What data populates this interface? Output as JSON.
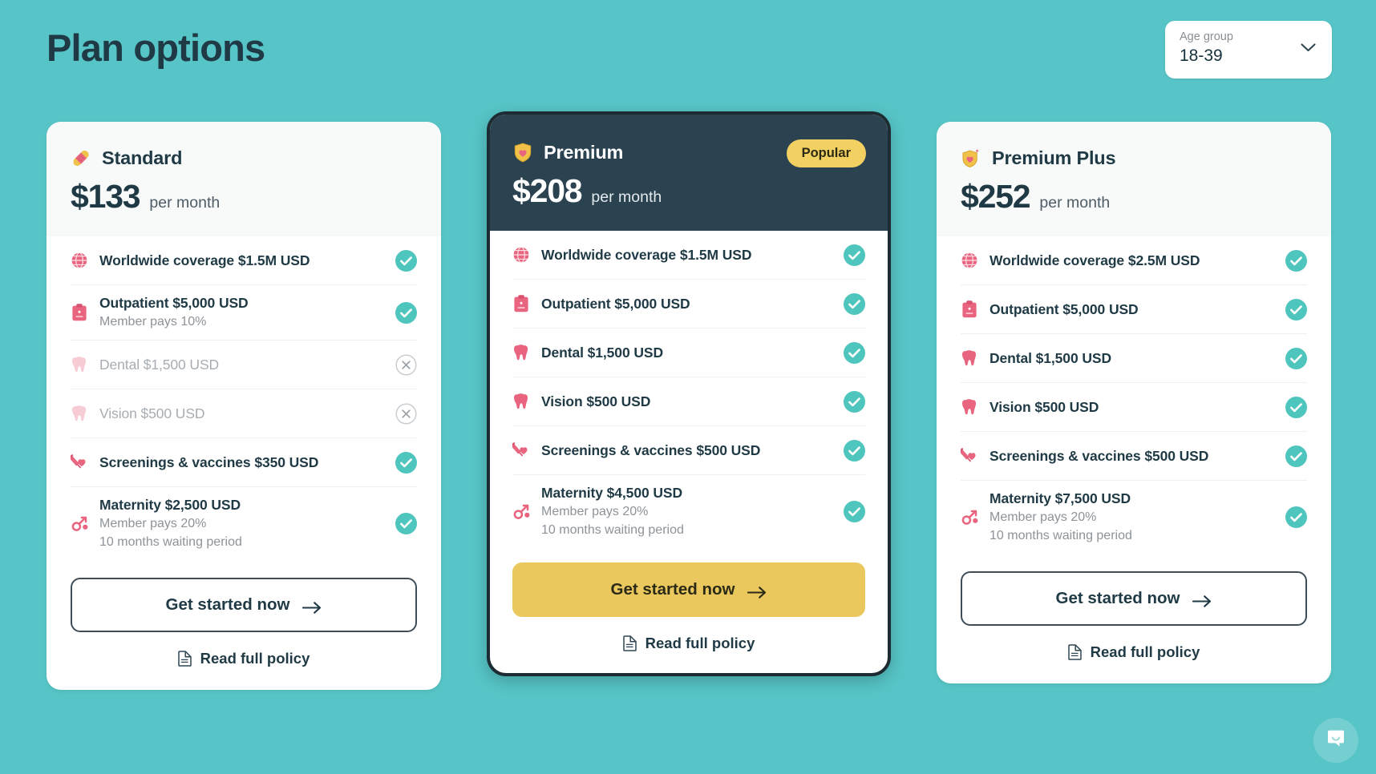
{
  "header": {
    "title": "Plan options",
    "age_group": {
      "label": "Age group",
      "value": "18-39",
      "chevron_icon": "chevron-down-icon"
    }
  },
  "common": {
    "cta_label": "Get started now",
    "policy_label": "Read full policy",
    "per_month": "per month",
    "arrow_icon": "arrow-right-icon",
    "doc_icon": "document-icon",
    "check_icon": "check-circle-icon",
    "cross_icon": "cross-circle-icon"
  },
  "colors": {
    "background_teal": "#57c5c7",
    "dark_navy": "#2b4250",
    "accent_yellow": "#ebc85e",
    "badge_yellow": "#f2d061",
    "check_teal": "#4ec5bd",
    "icon_pink": "#e8647f",
    "text_dark": "#1f3a45",
    "text_muted": "#8d9399",
    "text_disabled": "#a7adb2"
  },
  "chat": {
    "icon": "chat-bubble-icon"
  },
  "plans": [
    {
      "name": "Standard",
      "emoji_icon": "adhesive-bandage-icon",
      "price": "$133",
      "per_month": "per month",
      "featured": false,
      "badge": null,
      "cta_style": "outline",
      "features": [
        {
          "icon": "globe-icon",
          "title": "Worldwide coverage $1.5M USD",
          "subs": [],
          "included": true
        },
        {
          "icon": "clipboard-medical-icon",
          "title": "Outpatient $5,000 USD",
          "subs": [
            "Member pays 10%"
          ],
          "included": true
        },
        {
          "icon": "tooth-icon",
          "title": "Dental $1,500 USD",
          "subs": [],
          "included": false
        },
        {
          "icon": "tooth-icon",
          "title": "Vision $500 USD",
          "subs": [],
          "included": false
        },
        {
          "icon": "syringe-heart-icon",
          "title": "Screenings & vaccines $350 USD",
          "subs": [],
          "included": true
        },
        {
          "icon": "maternity-icon",
          "title": "Maternity $2,500 USD",
          "subs": [
            "Member pays 20%",
            "10 months waiting period"
          ],
          "included": true
        }
      ]
    },
    {
      "name": "Premium",
      "emoji_icon": "shield-heart-icon",
      "price": "$208",
      "per_month": "per month",
      "featured": true,
      "badge": "Popular",
      "cta_style": "primary",
      "features": [
        {
          "icon": "globe-icon",
          "title": "Worldwide coverage $1.5M USD",
          "subs": [],
          "included": true
        },
        {
          "icon": "clipboard-medical-icon",
          "title": "Outpatient $5,000 USD",
          "subs": [],
          "included": true
        },
        {
          "icon": "tooth-icon",
          "title": "Dental $1,500 USD",
          "subs": [],
          "included": true
        },
        {
          "icon": "tooth-icon",
          "title": "Vision $500 USD",
          "subs": [],
          "included": true
        },
        {
          "icon": "syringe-heart-icon",
          "title": "Screenings & vaccines $500 USD",
          "subs": [],
          "included": true
        },
        {
          "icon": "maternity-icon",
          "title": "Maternity $4,500 USD",
          "subs": [
            "Member pays 20%",
            "10 months waiting period"
          ],
          "included": true
        }
      ]
    },
    {
      "name": "Premium Plus",
      "emoji_icon": "shield-heart-sparkle-icon",
      "price": "$252",
      "per_month": "per month",
      "featured": false,
      "badge": null,
      "cta_style": "outline",
      "features": [
        {
          "icon": "globe-icon",
          "title": "Worldwide coverage $2.5M USD",
          "subs": [],
          "included": true
        },
        {
          "icon": "clipboard-medical-icon",
          "title": "Outpatient $5,000 USD",
          "subs": [],
          "included": true
        },
        {
          "icon": "tooth-icon",
          "title": "Dental $1,500 USD",
          "subs": [],
          "included": true
        },
        {
          "icon": "tooth-icon",
          "title": "Vision $500 USD",
          "subs": [],
          "included": true
        },
        {
          "icon": "syringe-heart-icon",
          "title": "Screenings & vaccines $500 USD",
          "subs": [],
          "included": true
        },
        {
          "icon": "maternity-icon",
          "title": "Maternity $7,500 USD",
          "subs": [
            "Member pays 20%",
            "10 months waiting period"
          ],
          "included": true
        }
      ]
    }
  ]
}
